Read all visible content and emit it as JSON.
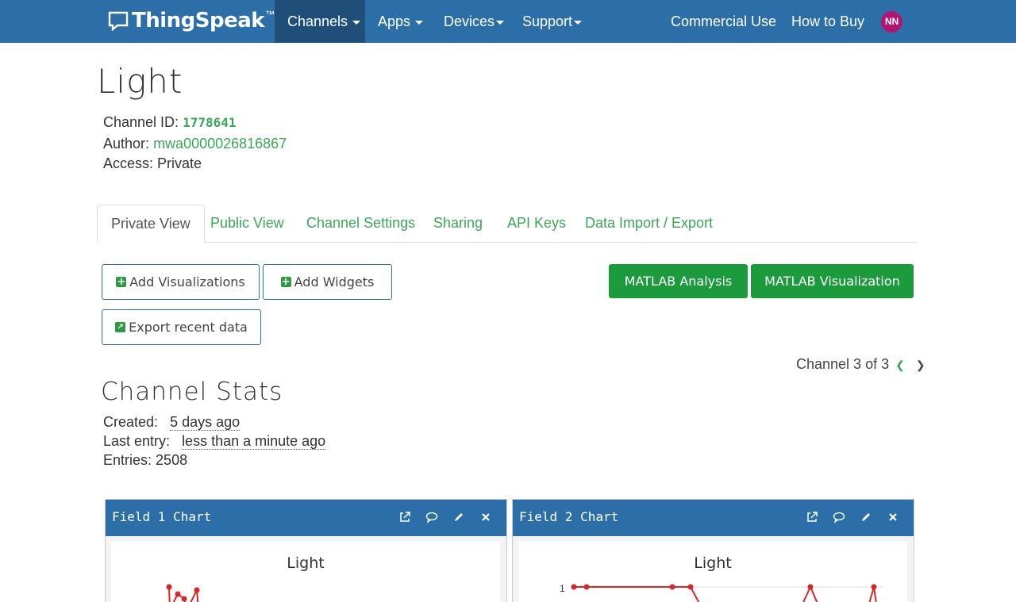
{
  "nav": {
    "logo_text": "ThingSpeak",
    "logo_tm": "™",
    "items": [
      {
        "label": "Channels"
      },
      {
        "label": "Apps"
      },
      {
        "label": "Devices"
      },
      {
        "label": "Support"
      }
    ],
    "commercial": "Commercial Use",
    "buy": "How to Buy",
    "avatar": "NN"
  },
  "channel": {
    "title": "Light",
    "id_label": "Channel ID:",
    "id_value": "1778641",
    "author_label": "Author:",
    "author_value": "mwa0000026816867",
    "access_label": "Access:",
    "access_value": "Private"
  },
  "tabs": [
    {
      "label": "Private View"
    },
    {
      "label": "Public View"
    },
    {
      "label": "Channel Settings"
    },
    {
      "label": "Sharing"
    },
    {
      "label": "API Keys"
    },
    {
      "label": "Data Import / Export"
    }
  ],
  "actions": {
    "add_visualizations": "Add Visualizations",
    "add_widgets": "Add Widgets",
    "export_recent": "Export recent data",
    "matlab_analysis": "MATLAB Analysis",
    "matlab_visualization": "MATLAB Visualization"
  },
  "pager": {
    "text": "Channel 3 of 3"
  },
  "stats": {
    "title": "Channel Stats",
    "created_label": "Created:",
    "created_value": "5 days ago",
    "last_label": "Last entry:",
    "last_value": "less than a minute ago",
    "entries_label": "Entries:",
    "entries_value": "2508"
  },
  "panels": [
    {
      "title": "Field 1 Chart",
      "chart_title": "Light"
    },
    {
      "title": "Field 2 Chart",
      "chart_title": "Light",
      "y_tick": "1"
    }
  ],
  "colors": {
    "nav": "#2c6fa8",
    "accent_green": "#3aa757",
    "button_green": "#1b9b3b",
    "series": "#d62728"
  }
}
